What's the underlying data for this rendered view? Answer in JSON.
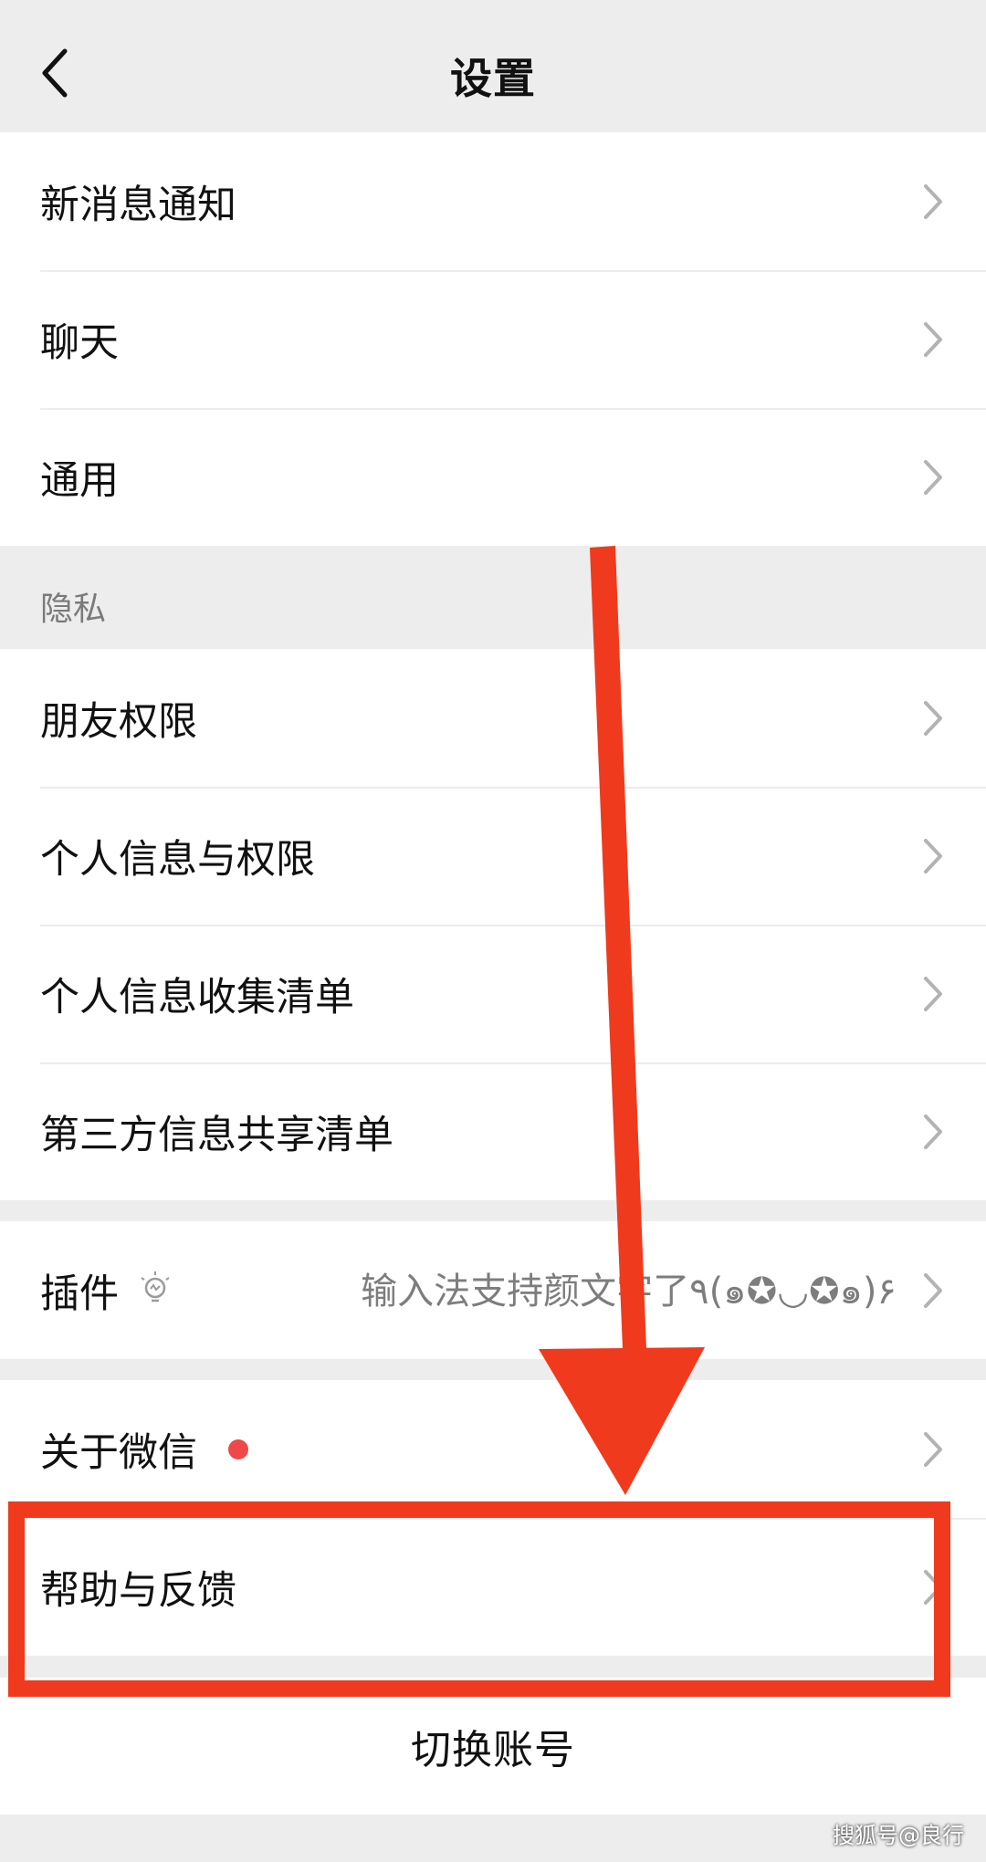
{
  "header": {
    "title": "设置"
  },
  "groups": {
    "general": [
      {
        "label": "新消息通知"
      },
      {
        "label": "聊天"
      },
      {
        "label": "通用"
      }
    ],
    "privacy_title": "隐私",
    "privacy": [
      {
        "label": "朋友权限"
      },
      {
        "label": "个人信息与权限"
      },
      {
        "label": "个人信息收集清单"
      },
      {
        "label": "第三方信息共享清单"
      }
    ],
    "plugins": {
      "label": "插件",
      "value": "输入法支持颜文字了٩(๑✪◡✪๑)۶"
    },
    "about": {
      "label": "关于微信"
    },
    "help": {
      "label": "帮助与反馈"
    }
  },
  "switch_account": {
    "label": "切换账号"
  },
  "annotation": {
    "highlight_color": "#ef3a1d"
  },
  "watermark": {
    "text": "搜狐号@良行"
  }
}
